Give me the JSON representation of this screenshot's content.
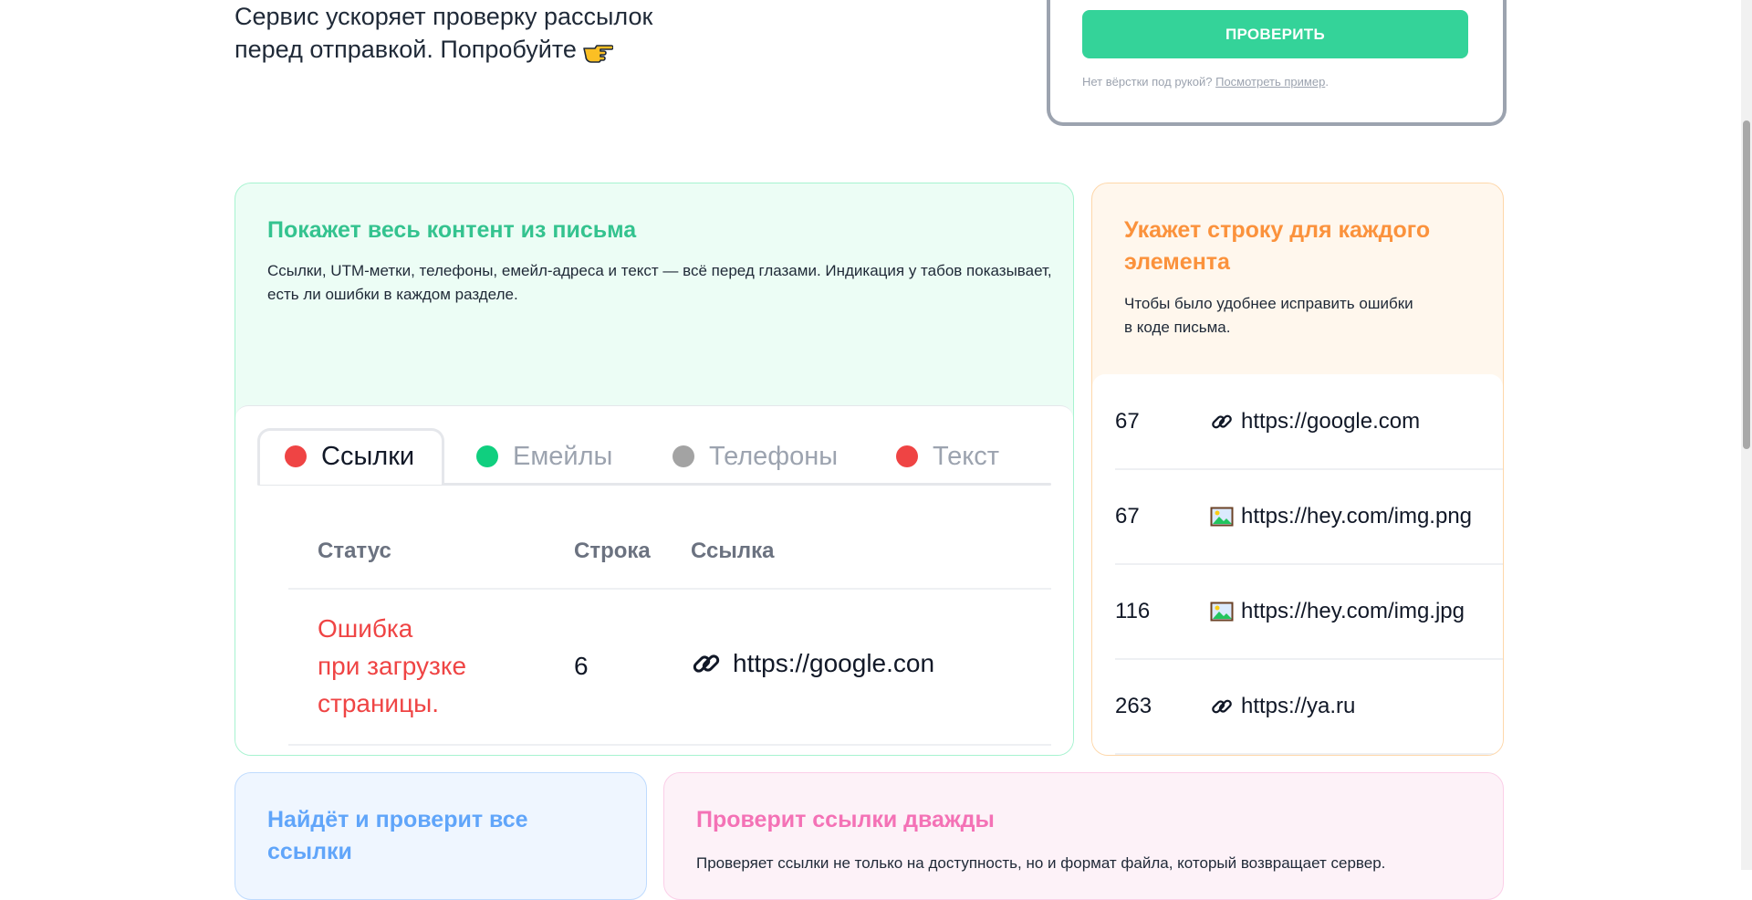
{
  "intro": {
    "line1": "Сервис ускоряет проверку рассылок",
    "line2": "перед отправкой. Попробуйте"
  },
  "check_panel": {
    "button_label": "ПРОВЕРИТЬ",
    "hint_text": "Нет вёрстки под рукой?",
    "example_link": "Посмотреть пример",
    "hint_end": "."
  },
  "content_card": {
    "title": "Покажет весь контент из письма",
    "description": "Ссылки, UTM-метки, телефоны, емейл-адреса и текст — всё перед глазами. Индикация у табов показывает, есть ли ошибки в каждом разделе.",
    "tabs": [
      {
        "label": "Ссылки",
        "color": "#ef4444"
      },
      {
        "label": "Емейлы",
        "color": "#10cf7f"
      },
      {
        "label": "Телефоны",
        "color": "#a3a3a3"
      },
      {
        "label": "Текст",
        "color": "#ef4444"
      }
    ],
    "table": {
      "headers": {
        "status": "Статус",
        "line": "Строка",
        "link": "Ссылка"
      },
      "rows": [
        {
          "status_1": "Ошибка",
          "status_2": "при загрузке",
          "status_3": "страницы.",
          "line": "6",
          "link": "https://google.con",
          "icon": "link-icon"
        }
      ]
    }
  },
  "line_card": {
    "title": "Укажет строку для каждого элемента",
    "description_1": "Чтобы было удобнее исправить ошибки",
    "description_2": "в коде письма.",
    "rows": [
      {
        "line": "67",
        "link": "https://google.com",
        "icon": "link-icon"
      },
      {
        "line": "67",
        "link": "https://hey.com/img.png",
        "icon": "image-icon"
      },
      {
        "line": "116",
        "link": "https://hey.com/img.jpg",
        "icon": "image-icon"
      },
      {
        "line": "263",
        "link": "https://ya.ru",
        "icon": "link-icon"
      }
    ]
  },
  "find_card": {
    "title": "Найдёт и проверит все ссылки"
  },
  "double_check_card": {
    "title": "Проверит ссылки дважды",
    "description": "Проверяет ссылки не только на доступность, но и формат файла, который возвращает сервер."
  }
}
